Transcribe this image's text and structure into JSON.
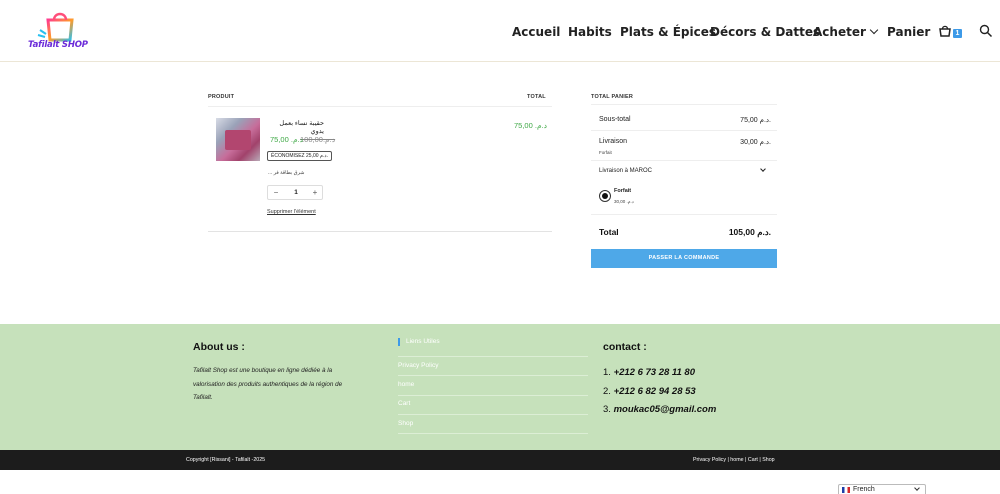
{
  "header": {
    "logo_text": "Tafilalt SHOP",
    "nav": [
      {
        "label": "Accueil"
      },
      {
        "label": "Habits"
      },
      {
        "label": "Plats & Épices"
      },
      {
        "label": "Décors & Dattes"
      },
      {
        "label": "Acheter"
      },
      {
        "label": "Panier"
      }
    ],
    "cart_count": "1",
    "icons": [
      "cart-icon",
      "search-icon",
      "chevron-down-icon"
    ]
  },
  "cart": {
    "col_product": "PRODUIT",
    "col_total": "TOTAL",
    "items": [
      {
        "name": "حقيبة نساء بعمل يدوي",
        "price_old": "د.م.100,00",
        "price_new": "د.م. 75,00",
        "save_badge": "ÉCONOMISEZ 25,00 د.م.",
        "note": "... شرق بطاقة فر",
        "qty": "1",
        "minus": "−",
        "plus": "+",
        "remove": "Supprimer l'élément",
        "total": "د.م. 75,00"
      }
    ]
  },
  "totals": {
    "title": "TOTAL PANIER",
    "subtotal_label": "Sous-total",
    "subtotal_value": "75,00 د.م.",
    "shipping_label": "Livraison",
    "shipping_value": "30,00 د.م.",
    "shipping_sub": "Forfait",
    "shipping_dest": "Livraison à MAROC",
    "option_label": "Forfait",
    "option_price": "د.م. 30,00",
    "total_label": "Total",
    "total_value": "105,00 د.م.",
    "checkout_label": "PASSER LA COMMANDE"
  },
  "footer": {
    "about_title": "About us :",
    "about_text": "Tafilalt Shop est une boutique en ligne dédiée à la valorisation des produits authentiques de la région de Tafilalt.",
    "links_title": "Liens Utiles",
    "links": [
      "Privacy Policy",
      "home",
      "Cart",
      "Shop"
    ],
    "contact_title": "contact :",
    "contacts": [
      "+212 6 73 28 11 80",
      "+212 6 82 94 28 53",
      "moukac05@gmail.com"
    ],
    "copyright": "Copyright [Rissani] - Tafilalt -2025",
    "bottom_links": [
      "Privacy Policy",
      "home",
      "Cart",
      "Shop"
    ],
    "separator": " | ",
    "language": "French"
  },
  "colors": {
    "accent": "#4ea8e8",
    "price_green": "#3ea845",
    "footer_bg": "#c6e1bb",
    "bottom_bar": "#1c1c1c"
  }
}
